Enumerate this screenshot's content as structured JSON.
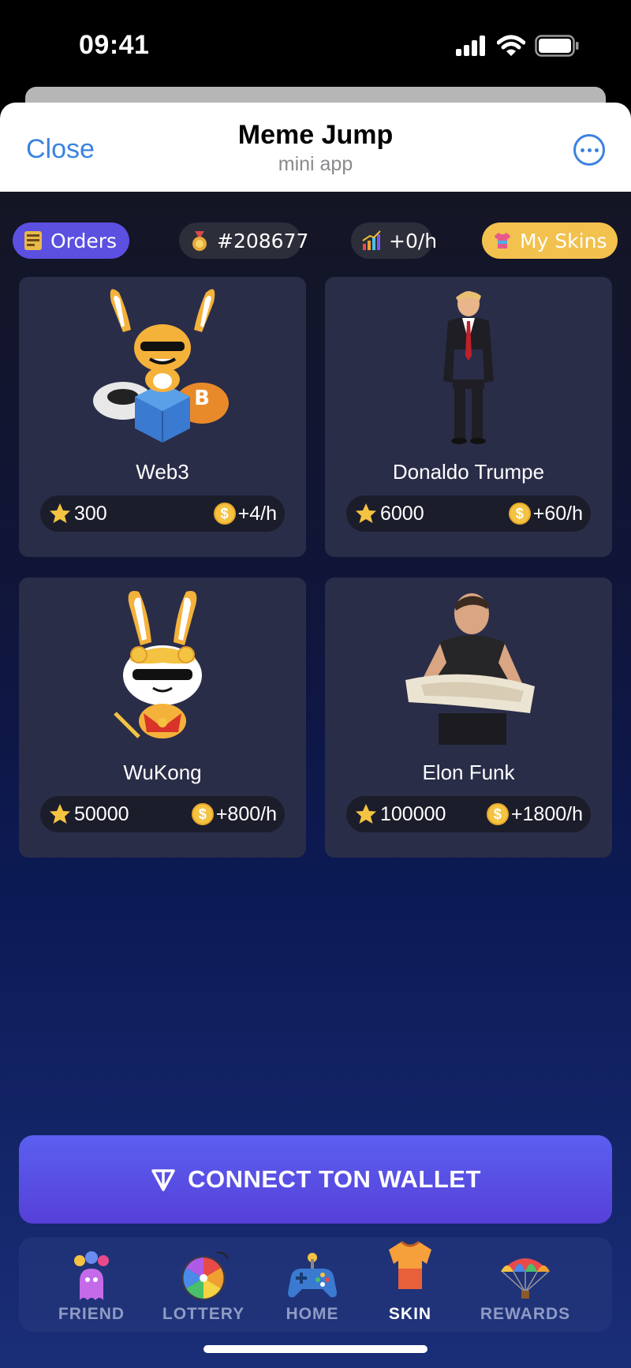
{
  "status_bar": {
    "time": "09:41"
  },
  "header": {
    "close_label": "Close",
    "title": "Meme Jump",
    "subtitle": "mini app"
  },
  "top_bar": {
    "orders_label": "Orders",
    "rank": "#208677",
    "rate": "+0/h",
    "my_skins_label": "My Skins"
  },
  "skins": [
    {
      "name": "Web3",
      "price": "300",
      "income": "+4/h"
    },
    {
      "name": "Donaldo Trumpe",
      "price": "6000",
      "income": "+60/h"
    },
    {
      "name": "WuKong",
      "price": "50000",
      "income": "+800/h"
    },
    {
      "name": "Elon Funk",
      "price": "100000",
      "income": "+1800/h"
    }
  ],
  "connect_button": {
    "label": "CONNECT TON WALLET"
  },
  "nav": [
    {
      "label": "FRIEND",
      "icon": "friend-icon"
    },
    {
      "label": "LOTTERY",
      "icon": "lottery-wheel-icon"
    },
    {
      "label": "HOME",
      "icon": "gamepad-icon"
    },
    {
      "label": "SKIN",
      "icon": "tshirt-icon",
      "active": true
    },
    {
      "label": "REWARDS",
      "icon": "parachute-icon"
    }
  ],
  "colors": {
    "accent": "#5b50e0",
    "skins_pill": "#f2c14e",
    "link": "#3b82e0"
  }
}
